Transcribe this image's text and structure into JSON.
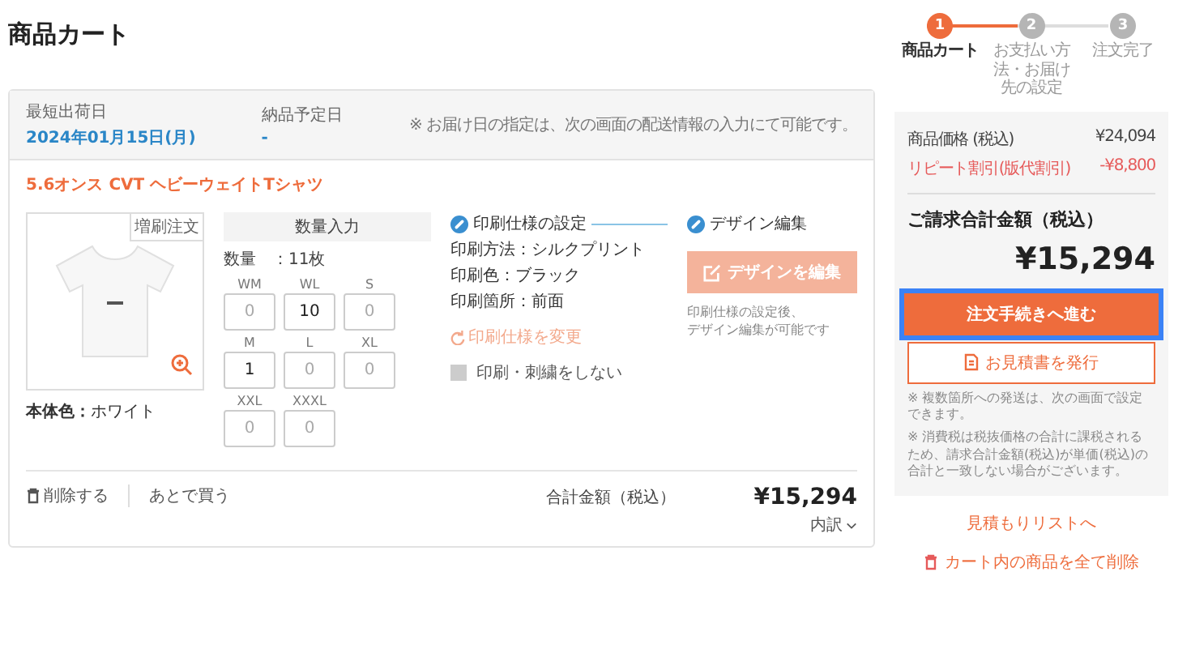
{
  "page_title": "商品カート",
  "delivery": {
    "earliest_label": "最短出荷日",
    "earliest_value": "2024年01月15日(月)",
    "planned_label": "納品予定日",
    "planned_value": "-",
    "note": "※ お届け日の指定は、次の画面の配送情報の入力にて可能です。"
  },
  "item": {
    "name": "5.6オンス CVT ヘビーウェイトTシャツ",
    "image_badge": "増刷注文",
    "body_color_label": "本体色：",
    "body_color_value": "ホワイト",
    "quantity": {
      "header": "数量入力",
      "total_label": "数量",
      "total_value": "：11枚",
      "sizes": [
        {
          "size": "WM",
          "placeholder": "0"
        },
        {
          "size": "WL",
          "value": "10"
        },
        {
          "size": "S",
          "placeholder": "0"
        },
        {
          "size": "M",
          "value": "1"
        },
        {
          "size": "L",
          "placeholder": "0"
        },
        {
          "size": "XL",
          "placeholder": "0"
        },
        {
          "size": "XXL",
          "placeholder": "0"
        },
        {
          "size": "XXXL",
          "placeholder": "0"
        }
      ]
    },
    "print_spec": {
      "title": "印刷仕様の設定",
      "lines": [
        {
          "label": "印刷方法",
          "value": "：シルクプリント"
        },
        {
          "label": "印刷色",
          "value": "：ブラック"
        },
        {
          "label": "印刷箇所",
          "value": "：前面"
        }
      ],
      "change_link": "印刷仕様を変更",
      "no_print": {
        "label": "印刷・刺繍をしない",
        "checked": false
      }
    },
    "design": {
      "title": "デザイン編集",
      "button": "デザインを編集",
      "disabled": true,
      "note": [
        "印刷仕様の設定後、",
        "デザイン編集が可能です"
      ]
    },
    "footer": {
      "delete": "削除する",
      "later": "あとで買う",
      "total_label": "合計金額（税込）",
      "total": "¥15,294",
      "breakdown": "内訳"
    }
  },
  "steps": [
    {
      "number": "1",
      "label": "商品カート",
      "selected": true
    },
    {
      "number": "2",
      "label": "お支払い方法・お届け先の設定",
      "selected": false
    },
    {
      "number": "3",
      "label": "注文完了",
      "selected": false
    }
  ],
  "summary": {
    "rows": [
      {
        "label": "商品価格 (税込)",
        "value": "¥24,094",
        "kind": "normal"
      },
      {
        "label": "リピート割引(版代割引)",
        "value": "-¥8,800",
        "kind": "discount"
      }
    ],
    "billing_label": "ご請求合計金額（税込）",
    "billing_total": "¥15,294",
    "proceed_button": {
      "label": "注文手続きへ進む",
      "focused": true
    },
    "quote_button": "お見積書を発行",
    "notes": [
      "※ 複数箇所への発送は、次の画面で設定できます。",
      "※ 消費税は税抜価格の合計に課税されるため、請求合計金額(税込)が単価(税込)の合計と一致しない場合がございます。"
    ]
  },
  "links": {
    "quote_list": "見積もりリストへ",
    "clear_cart": "カート内の商品を全て削除"
  }
}
